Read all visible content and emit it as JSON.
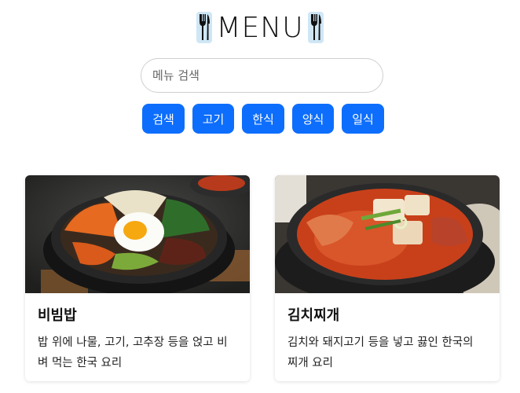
{
  "header": {
    "title": "MENU",
    "left_icon": "fork-knife-icon",
    "right_icon": "fork-knife-icon"
  },
  "search": {
    "placeholder": "메뉴 검색",
    "value": ""
  },
  "buttons": [
    {
      "label": "검색"
    },
    {
      "label": "고기"
    },
    {
      "label": "한식"
    },
    {
      "label": "양식"
    },
    {
      "label": "일식"
    }
  ],
  "colors": {
    "accent": "#0d6efd"
  },
  "cards": [
    {
      "title": "비빔밥",
      "description": "밥 위에 나물, 고기, 고추장 등을 얹고 비벼 먹는 한국 요리",
      "image_icon": "bibimbap-image"
    },
    {
      "title": "김치찌개",
      "description": "김치와 돼지고기 등을 넣고 끓인 한국의 찌개 요리",
      "image_icon": "kimchi-stew-image"
    }
  ]
}
